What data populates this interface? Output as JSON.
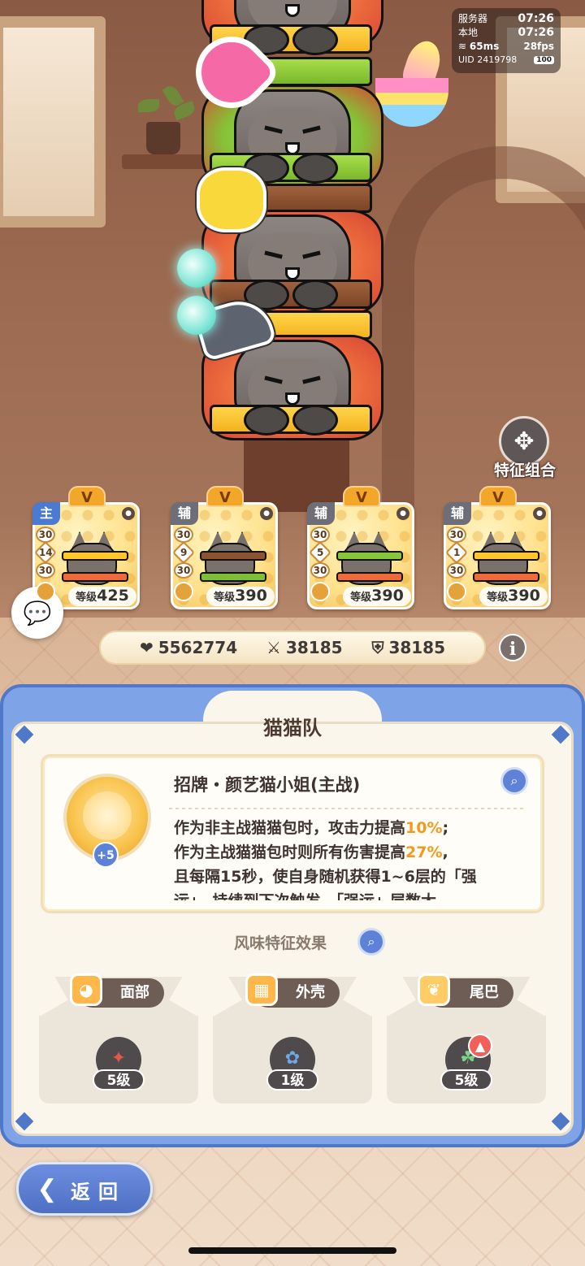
{
  "hud": {
    "server_label": "服务器",
    "server_time": "07:26",
    "local_label": "本地",
    "local_time": "07:26",
    "ping": "65ms",
    "fps": "28fps",
    "uid": "UID 2419798",
    "battery": "100"
  },
  "combo_button": {
    "label": "特征组合"
  },
  "team": [
    {
      "role": "主",
      "rank": "V",
      "chips": [
        "30",
        "14",
        "30"
      ],
      "level_label": "等级",
      "level": "425"
    },
    {
      "role": "辅",
      "rank": "V",
      "chips": [
        "30",
        "9",
        "30"
      ],
      "level_label": "等级",
      "level": "390"
    },
    {
      "role": "辅",
      "rank": "V",
      "chips": [
        "30",
        "5",
        "30"
      ],
      "level_label": "等级",
      "level": "390"
    },
    {
      "role": "辅",
      "rank": "V",
      "chips": [
        "30",
        "1",
        "30"
      ],
      "level_label": "等级",
      "level": "390"
    }
  ],
  "stats": {
    "hp": "5562774",
    "attack": "38185",
    "defense": "38185"
  },
  "panel": {
    "title": "猫猫队",
    "skill": {
      "name": "招牌・颜艺猫小姐(主战)",
      "plus": "+5",
      "line1_a": "作为非主战猫猫包时，攻击力提高",
      "line1_pct": "10%",
      "line1_b": ";",
      "line2_a": "作为主战猫猫包时则所有伤害提高",
      "line2_pct": "27%",
      "line2_b": ",",
      "line3": "且每隔15秒，使自身随机获得1~6层的「强",
      "line4": "运」，持续到下次触发。「强运」层数大"
    },
    "flavor_title": "风味特征效果",
    "traits": [
      {
        "label": "面部",
        "level": "5级"
      },
      {
        "label": "外壳",
        "level": "1级"
      },
      {
        "label": "尾巴",
        "level": "5级"
      }
    ]
  },
  "back_button": {
    "label": "返回"
  },
  "colors": {
    "accent_blue": "#5e82d8",
    "highlight_orange": "#f39a1c",
    "panel_bg": "#fbf6ec"
  }
}
